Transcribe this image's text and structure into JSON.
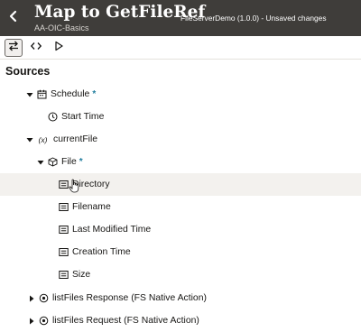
{
  "header": {
    "title": "Map to GetFileRef",
    "subtitle": "AA-OIC-Basics",
    "context": "FileServerDemo (1.0.0) - Unsaved changes"
  },
  "toolbar": {
    "buttons": [
      "swap-icon",
      "code-icon",
      "play-icon"
    ]
  },
  "sources": {
    "title": "Sources",
    "tree": [
      {
        "label": "Schedule",
        "star": "*",
        "icon": "calendar-icon",
        "expanded": true
      },
      {
        "label": "Start Time",
        "icon": "clock-icon"
      },
      {
        "label": "currentFile",
        "icon": "variable-icon",
        "icon_text": "(x)",
        "expanded": true
      },
      {
        "label": "File",
        "star": "*",
        "icon": "cube-icon",
        "expanded": true
      },
      {
        "label": "Directory",
        "icon": "element-icon",
        "hovered": true
      },
      {
        "label": "Filename",
        "icon": "element-icon"
      },
      {
        "label": "Last Modified Time",
        "icon": "element-icon"
      },
      {
        "label": "Creation Time",
        "icon": "element-icon"
      },
      {
        "label": "Size",
        "icon": "element-icon"
      },
      {
        "label": "listFiles Response (FS Native Action)",
        "icon": "target-icon",
        "expanded": false
      },
      {
        "label": "listFiles Request (FS Native Action)",
        "icon": "target-icon",
        "expanded": false
      }
    ]
  },
  "colors": {
    "header_bg": "#3f3d3a",
    "accent": "#227e9e",
    "hover_row": "#f3f1ee"
  }
}
